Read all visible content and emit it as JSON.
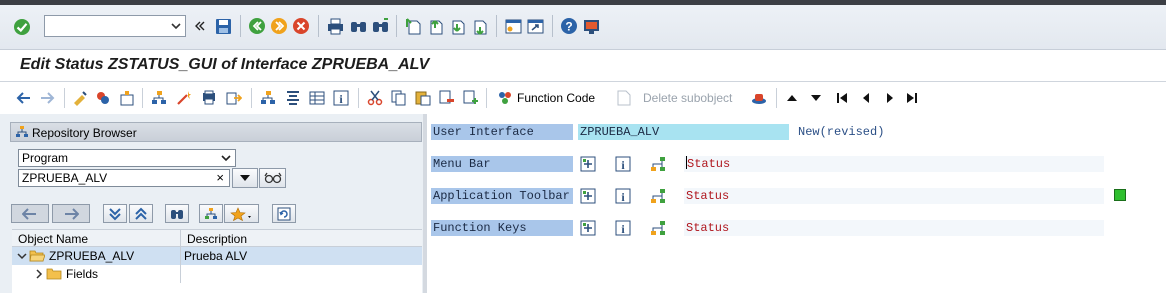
{
  "title": "Edit Status ZSTATUS_GUI of Interface ZPRUEBA_ALV",
  "toolbar": {
    "command_value": "",
    "icons": [
      "enter-icon",
      "save-icon",
      "back-icon",
      "exit-icon",
      "cancel-icon",
      "print-icon",
      "find-icon",
      "find-next-icon",
      "first-page-icon",
      "prev-page-icon",
      "next-page-icon",
      "last-page-icon",
      "new-session-icon",
      "shortcut-icon",
      "help-icon",
      "customize-icon"
    ]
  },
  "app_toolbar": {
    "function_code_label": "Function Code",
    "delete_subobject_label": "Delete subobject"
  },
  "repo": {
    "header": "Repository Browser",
    "type_value": "Program",
    "name_value": "ZPRUEBA_ALV",
    "clear_x": "×"
  },
  "tree": {
    "col_name": "Object Name",
    "col_desc": "Description",
    "rows": [
      {
        "name": "ZPRUEBA_ALV",
        "desc": "Prueba ALV"
      },
      {
        "name": "Fields",
        "desc": ""
      }
    ]
  },
  "interface": {
    "user_interface_label": "User Interface",
    "user_interface_value": "ZPRUEBA_ALV",
    "status_text": "New(revised)",
    "rows": [
      {
        "label": "Menu Bar",
        "value": "Status"
      },
      {
        "label": "Application Toolbar",
        "value": "Status"
      },
      {
        "label": "Function Keys",
        "value": "Status"
      }
    ]
  },
  "colors": {
    "accent_blue": "#a9c6ea",
    "status_red": "#b0171f",
    "ok_green": "#2fbf2f"
  }
}
